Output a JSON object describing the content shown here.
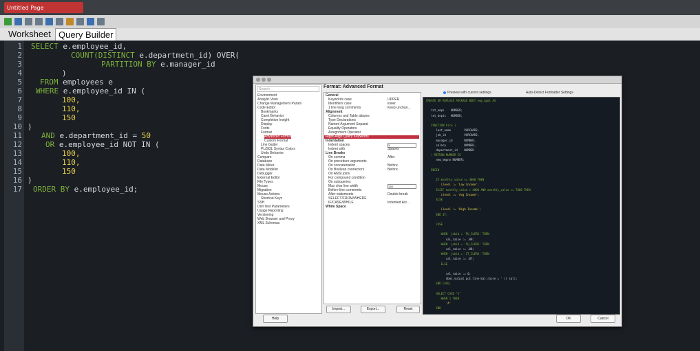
{
  "window": {
    "title": "Untitled Page"
  },
  "tabs": [
    {
      "label": "Worksheet"
    },
    {
      "label": "Query Builder"
    }
  ],
  "editor": {
    "line_numbers": [
      "1",
      "2",
      "3",
      "4",
      "5",
      "6",
      "7",
      "8",
      "9",
      "10",
      "11",
      "12",
      "13",
      "14",
      "15",
      "16",
      "17"
    ],
    "lines": [
      {
        "kw": "SELECT",
        "text": " e.employee_id,"
      },
      {
        "kw": "COUNT(DISTINCT",
        "text": " e.departmetn_id) OVER("
      },
      {
        "kw": "PARTITION BY",
        "text": " e.manager_id"
      },
      {
        "text": ")"
      },
      {
        "kw": "FROM",
        "text": " employees e"
      },
      {
        "kw": "WHERE",
        "text": " e.employee_id IN ("
      },
      {
        "num": "100,"
      },
      {
        "num": "110,"
      },
      {
        "num": "150"
      },
      {
        "text": ")"
      },
      {
        "kw": "AND",
        "text": " e.department_id = ",
        "num": "50"
      },
      {
        "kw": "OR",
        "text": " e.employee_id NOT IN ("
      },
      {
        "num": "100,"
      },
      {
        "num": "110,"
      },
      {
        "num": "150"
      },
      {
        "text": ")"
      },
      {
        "kw": "ORDER BY",
        "text": " e.employee_id;"
      }
    ]
  },
  "dialog": {
    "search_placeholder": "Search",
    "tree_items": [
      "Environment",
      "Analytic View",
      "Change Management Param",
      "Code Editor",
      "Bookmarks",
      "Caret Behavior",
      "Completion Insight",
      "Display",
      "Fonts",
      "Format",
      "Advanced Format",
      "Custom Format",
      "Line Gutter",
      "PL/SQL Syntax Colors",
      "Undo Behavior",
      "Compare",
      "Database",
      "Data Miner",
      "Data Modeler",
      "Debugger",
      "External Editor",
      "File Types",
      "Mouse",
      "Migration",
      "Mouse Actions",
      "Shortcut Keys",
      "SSH",
      "Unit Test Parameters",
      "Usage Reporting",
      "Versioning",
      "Web Browser and Proxy",
      "XML Schemas"
    ],
    "format_title": "Format: Advanced Format",
    "options": [
      {
        "label": "General",
        "value": ""
      },
      {
        "label": "Keywords case",
        "value": "UPPER"
      },
      {
        "label": "Identifiers case",
        "value": "lower"
      },
      {
        "label": "1 line long comments",
        "value": "Keep unchan..."
      },
      {
        "label": "Alignment",
        "value": ""
      },
      {
        "label": "Columns and Table aliases",
        "value": ""
      },
      {
        "label": "Type Declarations",
        "value": ""
      },
      {
        "label": "Named Argument Separat",
        "value": ""
      },
      {
        "label": "Equality Operators",
        "value": ""
      },
      {
        "label": "Assignment Operator",
        "value": ""
      },
      {
        "label": "Right-Align Query Keywords",
        "value": ""
      },
      {
        "label": "Indentation",
        "value": ""
      },
      {
        "label": "Indent spaces",
        "value": ""
      },
      {
        "label": "Indent with",
        "value": "Spaces"
      },
      {
        "label": "Line Breaks",
        "value": ""
      },
      {
        "label": "On comma",
        "value": "After"
      },
      {
        "label": "On procedure arguments",
        "value": ""
      },
      {
        "label": "On concatenation",
        "value": "Before"
      },
      {
        "label": "On Boolean connectors",
        "value": "Before"
      },
      {
        "label": "On ANSI joins",
        "value": ""
      },
      {
        "label": "For compound condition",
        "value": ""
      },
      {
        "label": "On subqueries",
        "value": ""
      },
      {
        "label": "Max char line width",
        "value": ""
      },
      {
        "label": "Before line comments",
        "value": ""
      },
      {
        "label": "After statements",
        "value": "Double break"
      },
      {
        "label": "SELECT/FROM/WHERE",
        "value": ""
      },
      {
        "label": "IF/CASE/WHILE",
        "value": "Indented Act..."
      },
      {
        "label": "White Space",
        "value": ""
      }
    ],
    "indent_value": "3",
    "width_value": "128",
    "buttons": {
      "import": "Import...",
      "export": "Export...",
      "reset": "Reset"
    },
    "preview_options": {
      "opt1": "Preview with current settings",
      "opt2": "Auto-Detect Formatter Settings"
    },
    "preview_lines": [
      "CREATE OR REPLACE PACKAGE BODY emp_mgmt AS",
      "",
      "   tot_emps    NUMBER;",
      "   tot_depts   NUMBER;",
      "",
      "   FUNCTION hire (",
      "      last_name        VARCHAR2,",
      "      job_id           VARCHAR2,",
      "      manager_id       NUMBER,",
      "      salary           NUMBER,",
      "      department_id    NUMBER",
      "   ) RETURN NUMBER IS",
      "      new_empno NUMBER;",
      "",
      "   BEGIN",
      "",
      "      IF monthly_value <= 4000 THEN",
      "         ilevel := 'Low Income';",
      "      ELSIF monthly_value > 4000 AND monthly_value <= 7000 THEN",
      "         ilevel := 'Avg Income';",
      "      ELSE",
      "",
      "         ilevel := 'High Income';",
      "      END IF;",
      "",
      "      CASE",
      "",
      "         WHEN  jobid = 'PU_CLERK' THEN",
      "            sal_raise := .09;",
      "         WHEN  jobid = 'SH_CLERK' THEN",
      "            sal_raise := .08;",
      "         WHEN  jobid = 'ST_CLERK' THEN",
      "            sal_raise := .07;",
      "         ELSE",
      "",
      "            sal_raise := 0;",
      "            dbms_output.put_line(sal_raise = ' || sal);",
      "      END CASE;",
      "",
      "      SELECT CASE \"1\"",
      "         WHEN 1 THEN",
      "            'A'",
      "      END"
    ],
    "help": "Help",
    "ok": "OK",
    "cancel": "Cancel"
  },
  "colors": {
    "accent": "#c0303f",
    "keyword": "#7fb23c",
    "number": "#e8d14b"
  }
}
